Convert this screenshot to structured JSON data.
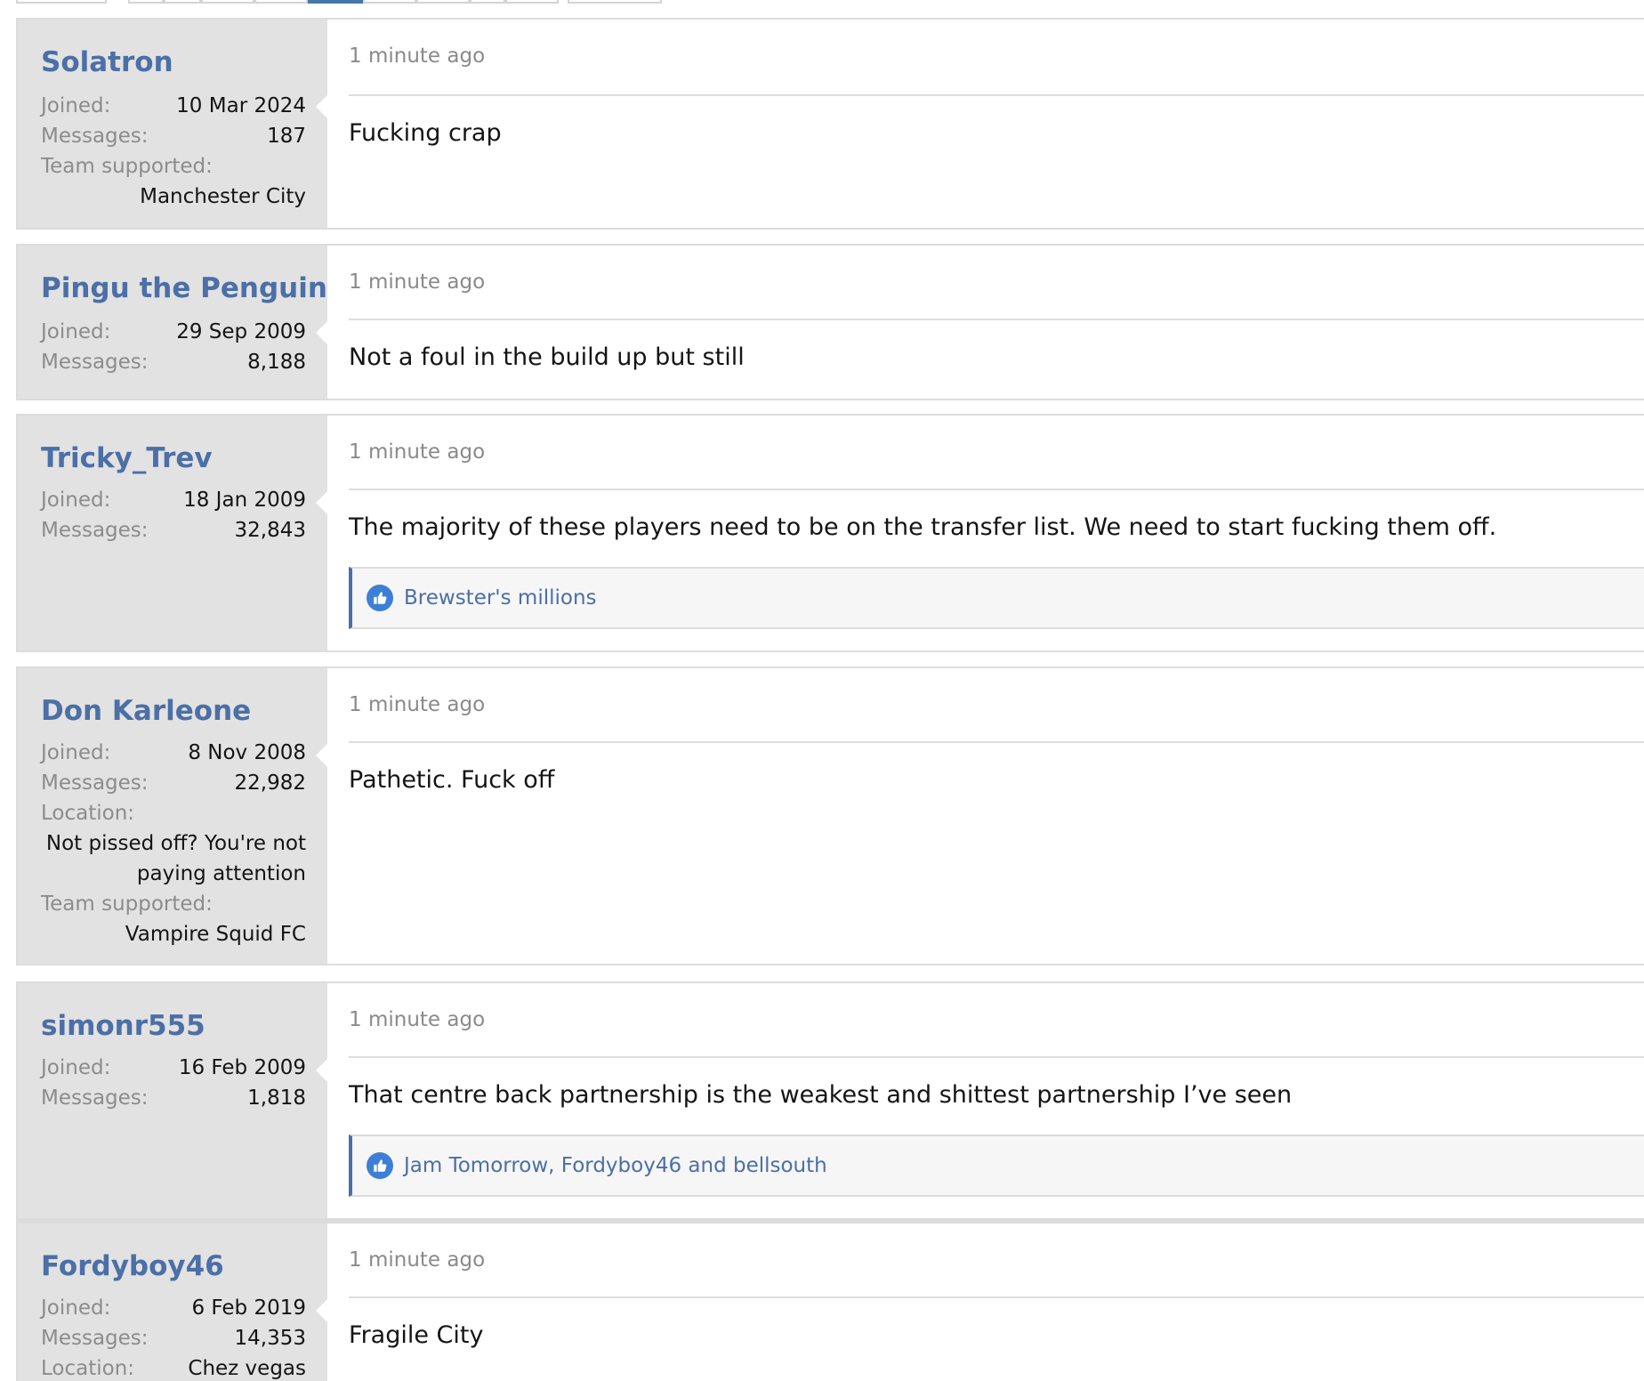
{
  "colors": {
    "accent": "#4b6fa6",
    "sidebar_bg": "#e2e2e2",
    "muted": "#8c8c8c",
    "like_icon": "#3d7fd6"
  },
  "posts": [
    {
      "username": "Solatron",
      "joined_label": "Joined:",
      "joined": "10 Mar 2024",
      "messages_label": "Messages:",
      "messages": "187",
      "team_label": "Team supported:",
      "team": "Manchester City",
      "time": "1 minute ago",
      "text": "Fucking crap"
    },
    {
      "username": "Pingu the Penguin",
      "joined_label": "Joined:",
      "joined": "29 Sep 2009",
      "messages_label": "Messages:",
      "messages": "8,188",
      "time": "1 minute ago",
      "text": "Not a foul in the build up but still"
    },
    {
      "username": "Tricky_Trev",
      "joined_label": "Joined:",
      "joined": "18 Jan 2009",
      "messages_label": "Messages:",
      "messages": "32,843",
      "time": "1 minute ago",
      "text": "The majority of these players need to be on the transfer list. We need to start fucking them off.",
      "likes": "Brewster's millions"
    },
    {
      "username": "Don Karleone",
      "joined_label": "Joined:",
      "joined": "8 Nov 2008",
      "messages_label": "Messages:",
      "messages": "22,982",
      "location_label": "Location:",
      "location_line1": "Not pissed off? You're not",
      "location_line2": "paying attention",
      "team_label": "Team supported:",
      "team": "Vampire Squid FC",
      "time": "1 minute ago",
      "text": "Pathetic. Fuck off"
    },
    {
      "username": "simonr555",
      "joined_label": "Joined:",
      "joined": "16 Feb 2009",
      "messages_label": "Messages:",
      "messages": "1,818",
      "time": "1 minute ago",
      "text": "That centre back partnership is the weakest and shittest partnership I’ve seen",
      "likes": "Jam Tomorrow, Fordyboy46 and bellsouth"
    },
    {
      "username": "Fordyboy46",
      "joined_label": "Joined:",
      "joined": "6 Feb 2019",
      "messages_label": "Messages:",
      "messages": "14,353",
      "location_label": "Location:",
      "location": "Chez vegas",
      "time": "1 minute ago",
      "text": "Fragile City"
    }
  ]
}
